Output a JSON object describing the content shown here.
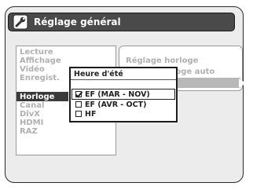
{
  "header": {
    "title": "Réglage général",
    "icon": "wrench-icon"
  },
  "menu": {
    "items": [
      {
        "label": "Lecture"
      },
      {
        "label": "Affichage"
      },
      {
        "label": "Vidéo"
      },
      {
        "label": "Enregist."
      },
      {
        "label": "Horloge",
        "active": true
      },
      {
        "label": "Canal"
      },
      {
        "label": "DivX"
      },
      {
        "label": "HDMI"
      },
      {
        "label": "RAZ"
      }
    ]
  },
  "submenu": {
    "items": [
      {
        "label": "Réglage horloge"
      },
      {
        "label": "loge auto"
      }
    ]
  },
  "dialog": {
    "title": "Heure d'été",
    "options": [
      {
        "label": "EF (MAR - NOV)",
        "checked": true
      },
      {
        "label": "EF (AVR - OCT)",
        "checked": false
      },
      {
        "label": "HF",
        "checked": false
      }
    ]
  },
  "colors": {
    "title_bar": "#4a4a4a",
    "menu_text": "#b0b0b0",
    "active_bg": "#3a3a3a"
  }
}
